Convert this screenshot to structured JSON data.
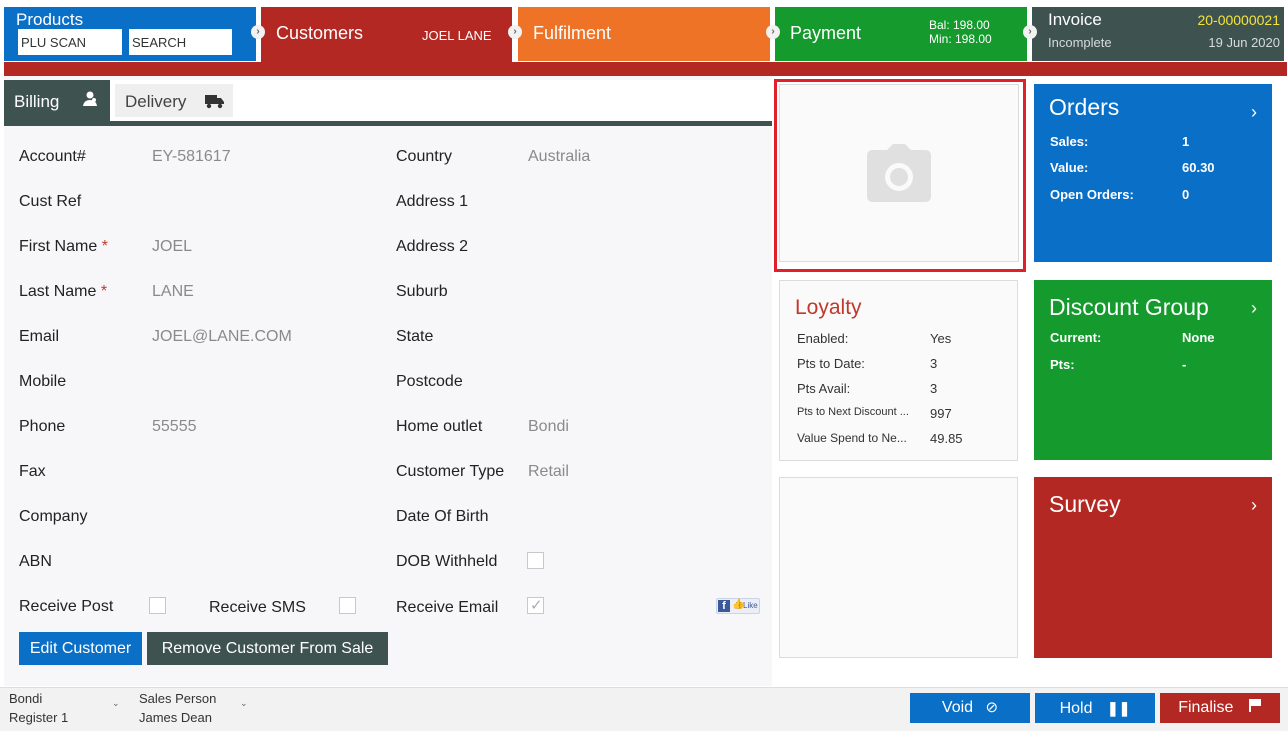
{
  "nav": {
    "products": {
      "title": "Products",
      "plu_placeholder": "PLU SCAN",
      "search_placeholder": "SEARCH"
    },
    "customers": {
      "title": "Customers",
      "name": "JOEL LANE"
    },
    "fulfilment": {
      "title": "Fulfilment"
    },
    "payment": {
      "title": "Payment",
      "bal": "Bal: 198.00",
      "min": "Min: 198.00"
    },
    "invoice": {
      "title": "Invoice",
      "number": "20-00000021",
      "status": "Incomplete",
      "date": "19 Jun 2020"
    }
  },
  "tabs": {
    "billing": "Billing",
    "delivery": "Delivery"
  },
  "form": {
    "left": [
      {
        "label": "Account#",
        "value": "EY-581617",
        "required": false
      },
      {
        "label": "Cust Ref",
        "value": "",
        "required": false
      },
      {
        "label": "First Name",
        "value": "JOEL",
        "required": true
      },
      {
        "label": "Last Name",
        "value": "LANE",
        "required": true
      },
      {
        "label": "Email",
        "value": "JOEL@LANE.COM",
        "required": false
      },
      {
        "label": "Mobile",
        "value": "",
        "required": false
      },
      {
        "label": "Phone",
        "value": "55555",
        "required": false
      },
      {
        "label": "Fax",
        "value": "",
        "required": false
      },
      {
        "label": "Company",
        "value": "",
        "required": false
      },
      {
        "label": "ABN",
        "value": "",
        "required": false
      }
    ],
    "right": [
      {
        "label": "Country",
        "value": "Australia"
      },
      {
        "label": "Address 1",
        "value": ""
      },
      {
        "label": "Address 2",
        "value": ""
      },
      {
        "label": "Suburb",
        "value": ""
      },
      {
        "label": "State",
        "value": ""
      },
      {
        "label": "Postcode",
        "value": ""
      },
      {
        "label": "Home outlet",
        "value": "Bondi"
      },
      {
        "label": "Customer Type",
        "value": "Retail"
      },
      {
        "label": "Date Of Birth",
        "value": ""
      },
      {
        "label": "DOB Withheld",
        "value": ""
      }
    ],
    "required_mark": "*",
    "receive_post": "Receive Post",
    "receive_sms": "Receive SMS",
    "receive_email": "Receive Email",
    "fb_like": "Like"
  },
  "buttons": {
    "edit": "Edit Customer",
    "remove": "Remove Customer From Sale"
  },
  "loyalty": {
    "title": "Loyalty",
    "rows": [
      {
        "k": "Enabled:",
        "v": "Yes"
      },
      {
        "k": "Pts to Date:",
        "v": "3"
      },
      {
        "k": "Pts Avail:",
        "v": "3"
      },
      {
        "k": "Pts to Next Discount ...",
        "v": "997"
      },
      {
        "k": "Value Spend to Ne...",
        "v": "49.85"
      }
    ]
  },
  "orders": {
    "title": "Orders",
    "rows": [
      {
        "k": "Sales:",
        "v": "1"
      },
      {
        "k": "Value:",
        "v": "60.30"
      },
      {
        "k": "Open Orders:",
        "v": "0"
      }
    ]
  },
  "discount": {
    "title": "Discount Group",
    "rows": [
      {
        "k": "Current:",
        "v": "None"
      },
      {
        "k": "Pts:",
        "v": "-"
      }
    ]
  },
  "survey": {
    "title": "Survey"
  },
  "footer": {
    "outlet": "Bondi",
    "register": "Register 1",
    "sp_label": "Sales Person",
    "sp_name": "James Dean",
    "void": "Void",
    "hold": "Hold",
    "finalise": "Finalise"
  },
  "colors": {
    "blue": "#0a6fc7",
    "red": "#b32822",
    "orange": "#ef7326",
    "green": "#159a2e",
    "slate": "#3e5250",
    "highlight": "#e0202a"
  }
}
